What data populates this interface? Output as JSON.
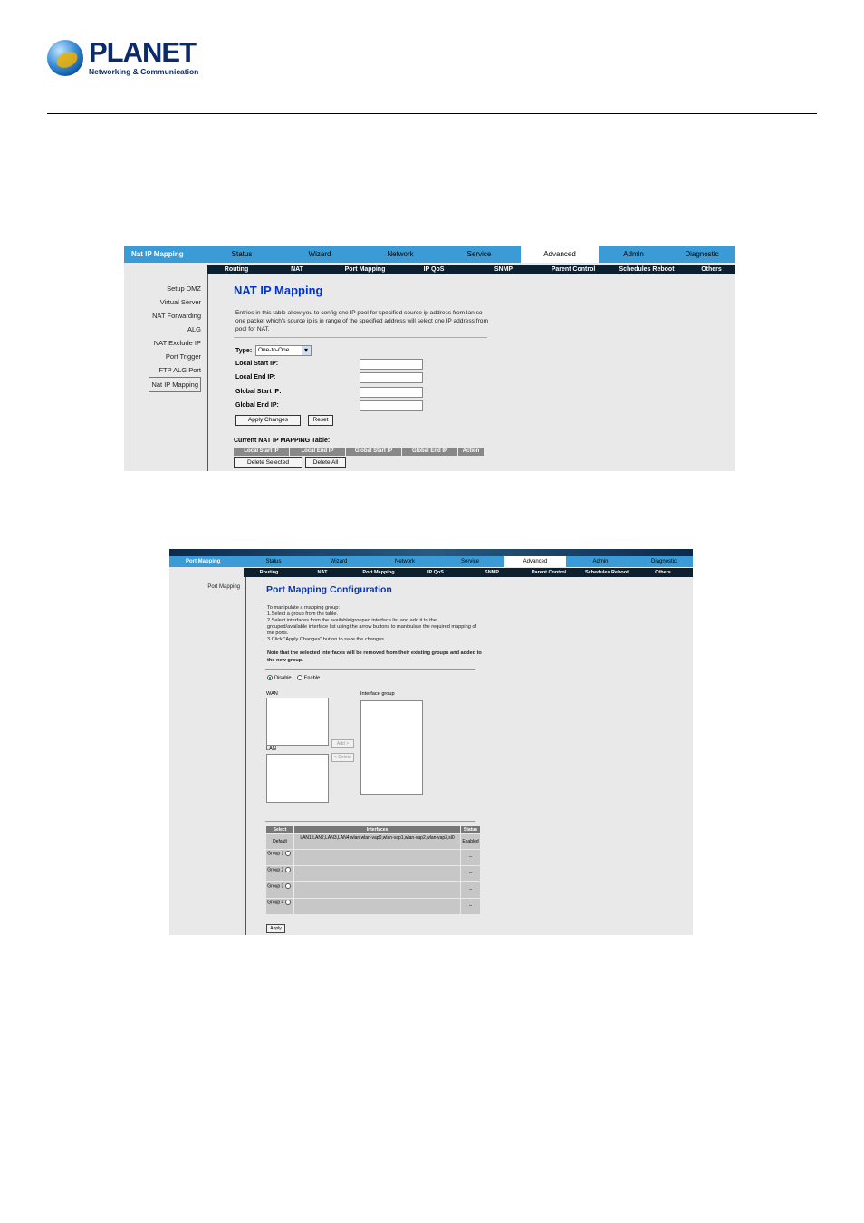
{
  "header": {
    "logo_word": "PLANET",
    "logo_tagline": "Networking & Communication"
  },
  "nat_screen": {
    "page_label": "Nat IP Mapping",
    "top_nav": [
      "Status",
      "Wizard",
      "Network",
      "Service",
      "Advanced",
      "Admin",
      "Diagnostic"
    ],
    "active_tab": "Advanced",
    "sub_nav": [
      "Routing",
      "NAT",
      "Port Mapping",
      "IP QoS",
      "SNMP",
      "Parent Control",
      "Schedules Reboot",
      "Others"
    ],
    "sidebar": [
      "Setup DMZ",
      "Virtual Server",
      "NAT Forwarding",
      "ALG",
      "NAT Exclude IP",
      "Port Trigger",
      "FTP ALG Port",
      "Nat IP Mapping"
    ],
    "title": "NAT IP Mapping",
    "description": "Entries in this table allow you to config one IP pool for specified source ip address from lan,so one packet which's source ip is in range of the specified address will select one IP address from pool for NAT.",
    "type_label": "Type:",
    "type_value": "One-to-One",
    "fields": [
      "Local Start IP:",
      "Local End IP:",
      "Global Start IP:",
      "Global End IP:"
    ],
    "apply_button": "Apply Changes",
    "reset_button": "Reset",
    "table_title": "Current NAT IP MAPPING Table:",
    "table_headers": [
      "Local Start IP",
      "Local End IP",
      "Global Start IP",
      "Global End IP",
      "Action"
    ],
    "delete_selected": "Delete Selected",
    "delete_all": "Delete All"
  },
  "port_screen": {
    "page_label": "Port Mapping",
    "top_nav": [
      "Status",
      "Wizard",
      "Network",
      "Service",
      "Advanced",
      "Admin",
      "Diagnostic"
    ],
    "active_tab": "Advanced",
    "sub_nav": [
      "Routing",
      "NAT",
      "Port Mapping",
      "IP QoS",
      "SNMP",
      "Parent Control",
      "Schedules Reboot",
      "Others"
    ],
    "sidebar": [
      "Port Mapping"
    ],
    "title": "Port Mapping Configuration",
    "instructions": [
      "To manipulate a mapping group:",
      "1.Select a group from the table.",
      "2.Select interfaces from the available/grouped interface list and add it to the grouped/available interface list using the arrow buttons to manipulate the required mapping of the ports.",
      "3.Click \"Apply Changes\" button to save the changes."
    ],
    "note": "Note that the selected interfaces will be removed from their existing groups and added to the new group.",
    "disable_label": "Disable",
    "enable_label": "Enable",
    "wan_label": "WAN",
    "lan_label": "LAN",
    "interface_group_label": "Interface group",
    "add_button": "Add >",
    "delete_button": "< Delete",
    "table_headers": [
      "Select",
      "Interfaces",
      "Status"
    ],
    "rows": [
      {
        "select": "Default",
        "interfaces": "LAN1,LAN2,LAN3,LAN4,wlan,wlan-vap0,wlan-vap1,wlan-vap2,wlan-vap3,sl0",
        "status": "Enabled"
      },
      {
        "select": "Group 1",
        "interfaces": "",
        "status": "--"
      },
      {
        "select": "Group 2",
        "interfaces": "",
        "status": "--"
      },
      {
        "select": "Group 3",
        "interfaces": "",
        "status": "--"
      },
      {
        "select": "Group 4",
        "interfaces": "",
        "status": "--"
      }
    ],
    "apply_button": "Apply"
  }
}
